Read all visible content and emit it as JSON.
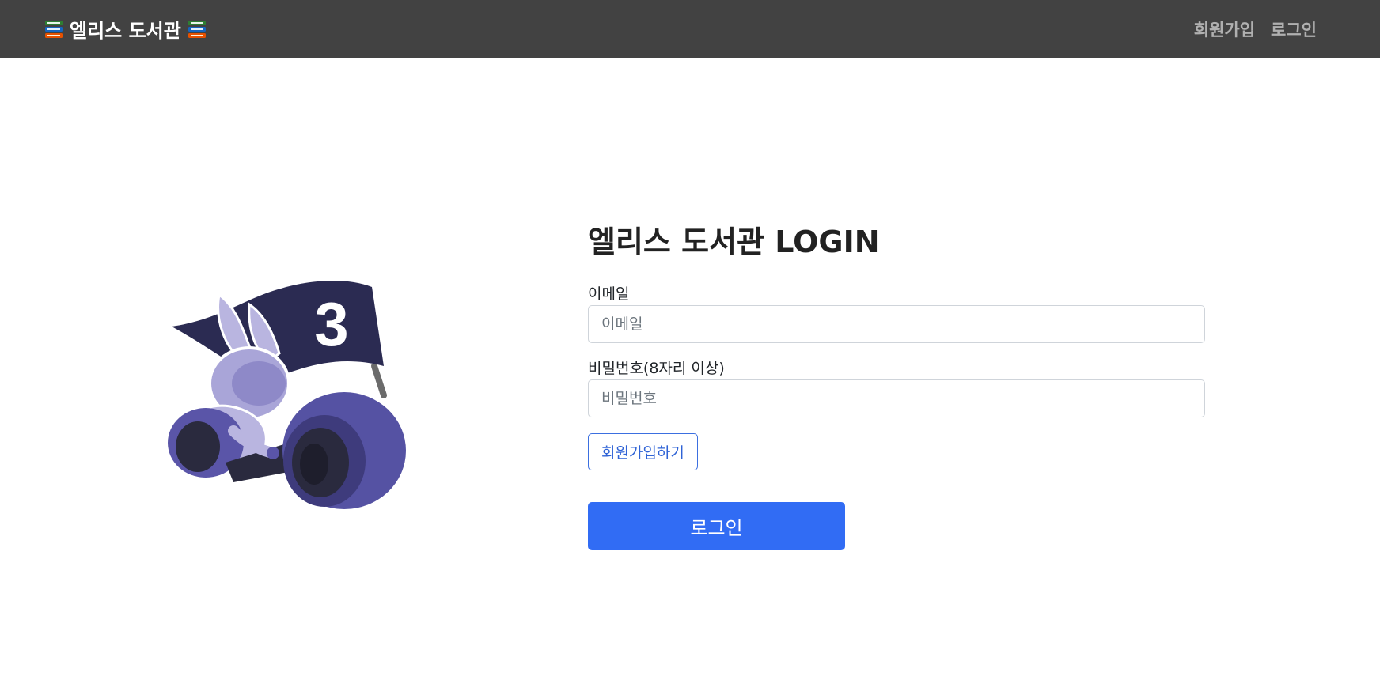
{
  "navbar": {
    "brand_title": "엘리스 도서관",
    "brand_icon": "books-icon",
    "links": [
      {
        "label": "회원가입"
      },
      {
        "label": "로그인"
      }
    ],
    "background_color": "#424242"
  },
  "mascot": {
    "icon": "rabbit-rider-mascot",
    "flag_number": "3"
  },
  "login": {
    "title": "엘리스 도서관 LOGIN",
    "email_label": "이메일",
    "email_placeholder": "이메일",
    "email_value": "",
    "password_label": "비밀번호(8자리 이상)",
    "password_placeholder": "비밀번호",
    "password_value": "",
    "signup_button": "회원가입하기",
    "login_button": "로그인",
    "accent_color": "#316cf4"
  }
}
